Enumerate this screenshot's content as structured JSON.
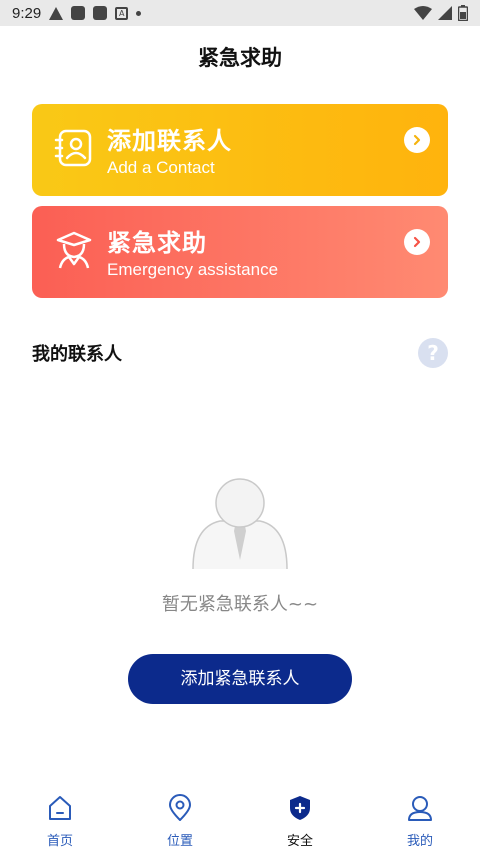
{
  "status_bar": {
    "time": "9:29",
    "a_label": "A"
  },
  "header": {
    "title": "紧急求助"
  },
  "cards": [
    {
      "title": "添加联系人",
      "subtitle": "Add a Contact"
    },
    {
      "title": "紧急求助",
      "subtitle": "Emergency assistance"
    }
  ],
  "contacts": {
    "section_title": "我的联系人",
    "help_label": "?",
    "empty_text": "暂无紧急联系人~~",
    "add_button_label": "添加紧急联系人"
  },
  "nav": {
    "items": [
      {
        "label": "首页",
        "icon": "home-icon"
      },
      {
        "label": "位置",
        "icon": "location-icon"
      },
      {
        "label": "安全",
        "icon": "shield-plus-icon",
        "active": true
      },
      {
        "label": "我的",
        "icon": "user-icon"
      }
    ]
  },
  "colors": {
    "accent": "#0c2a8c",
    "card_yellow": "#f9c916",
    "card_red": "#fb5f54",
    "nav_label": "#2a5bb9"
  }
}
